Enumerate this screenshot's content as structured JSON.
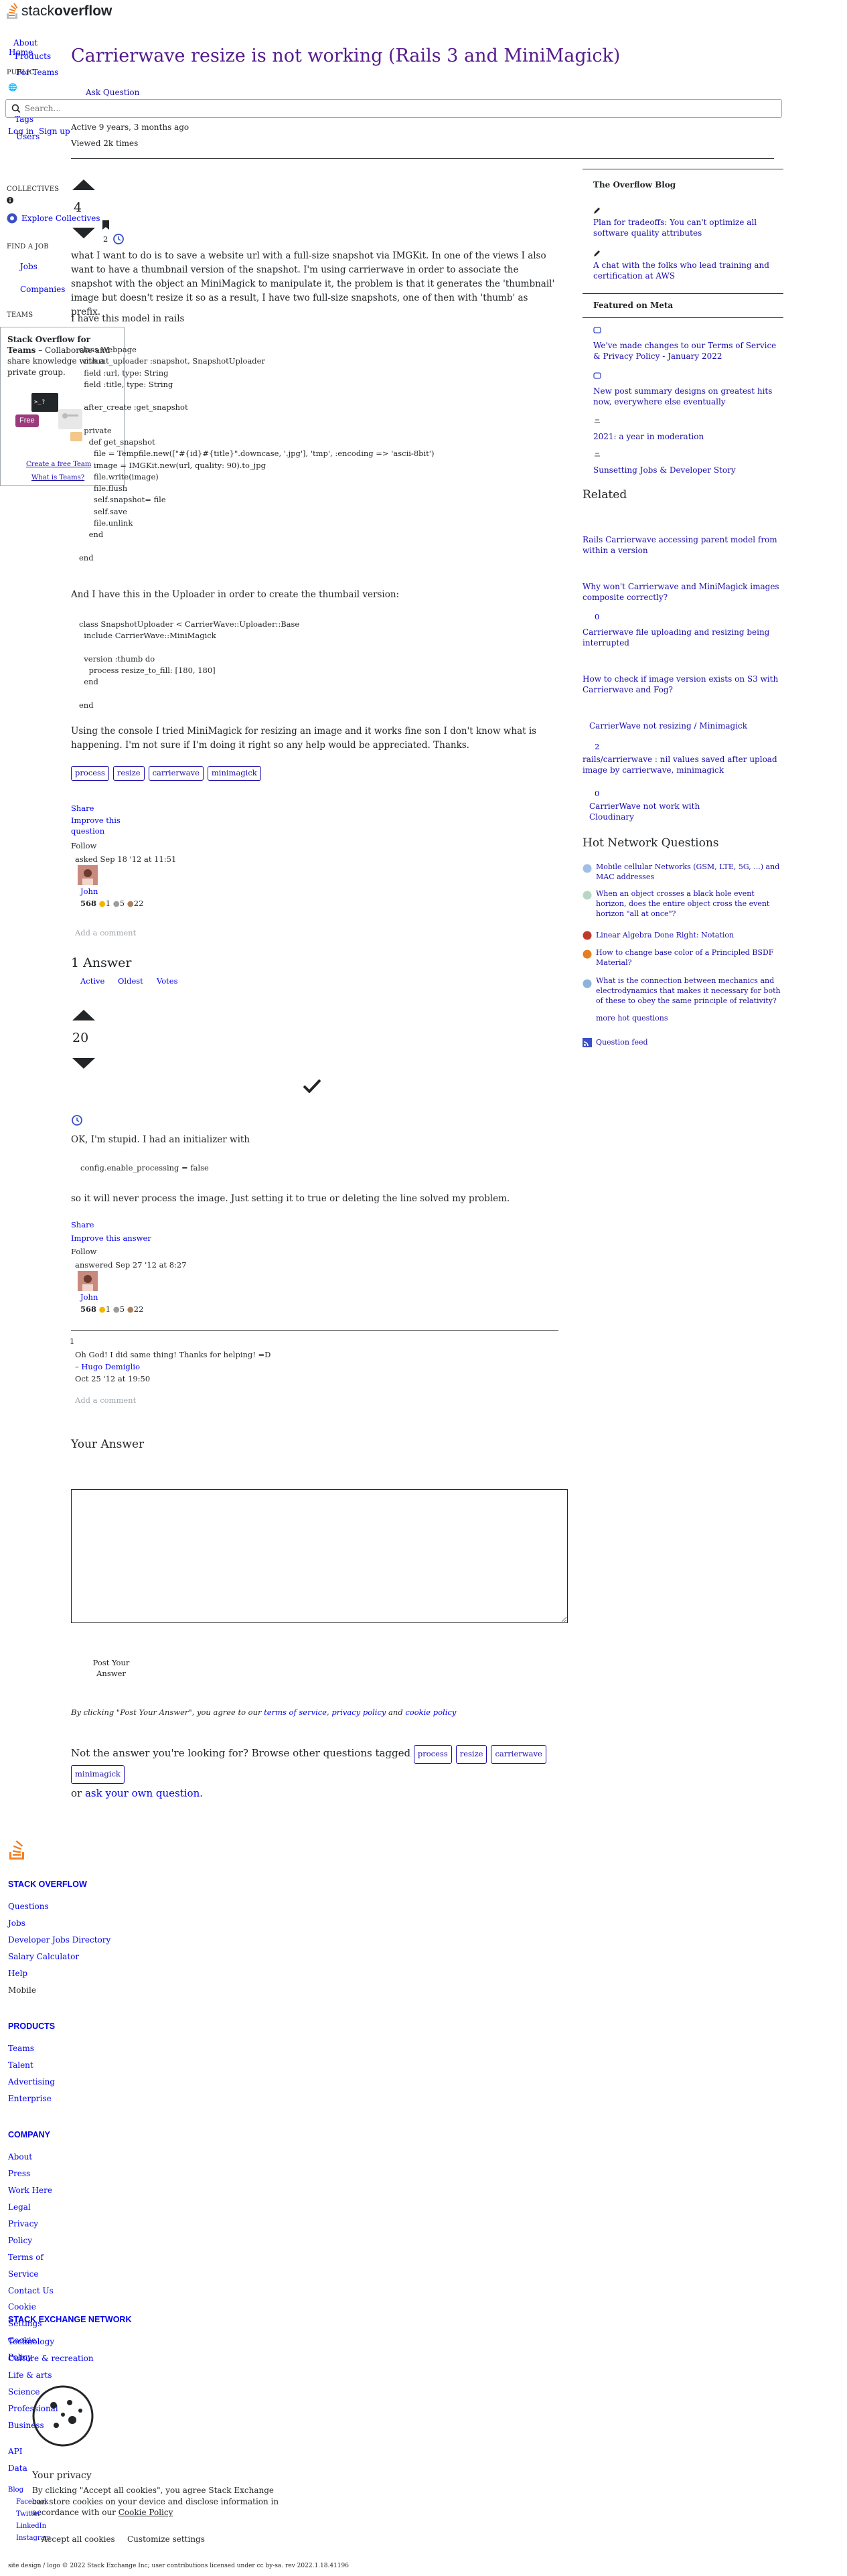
{
  "header": {
    "logo_text_light": "stack",
    "logo_text_bold": "overflow",
    "nav": [
      "Home",
      "About",
      "Products",
      "For Teams",
      "PUBLIC",
      "Stack Overflow",
      "Tags",
      "Users"
    ],
    "search_placeholder": "Search…",
    "login": "Log in",
    "signup": "Sign up"
  },
  "left_nav": {
    "collectives_label": "COLLECTIVES",
    "explore_collectives": "Explore Collectives",
    "find_a_job_label": "FIND A JOB",
    "jobs": "Jobs",
    "companies": "Companies",
    "teams_label": "TEAMS",
    "teams_box": {
      "title": "Stack Overflow for Teams",
      "desc": " – Collaborate and share knowledge with a private group.",
      "free_badge": "Free",
      "create_link": "Create a free Team",
      "what_link": "What is Teams?"
    }
  },
  "question": {
    "title": "Carrierwave resize is not working (Rails 3 and MiniMagick)",
    "ask_button": "Ask Question",
    "active": "Active 9 years, 3 months ago",
    "viewed": "Viewed 2k times",
    "votes": "4",
    "bookmarks": "2",
    "body_p1": "what I want to do is to save a website url with a full-size snapshot via IMGKit. In one of the views I also want to have a thumbnail version of the snapshot. I'm using carrierwave in order to associate the snapshot with the object an MiniMagick to manipulate it, the problem is that it generates the 'thumbnail' image but doesn't resize it so as a result, I have two full-size snapshots, one of then with 'thumb' as prefix.",
    "body_p2": "I have this model in rails",
    "code1": "class Webpage\n  mount_uploader :snapshot, SnapshotUploader\n  field :url, type: String\n  field :title, type: String\n\n  after_create :get_snapshot\n\n  private\n    def get_snapshot\n      file = Tempfile.new([\"#{id}#{title}\".downcase, '.jpg'], 'tmp', :encoding => 'ascii-8bit')\n      image = IMGKit.new(url, quality: 90).to_jpg\n      file.write(image)\n      file.flush\n      self.snapshot= file\n      self.save\n      file.unlink\n    end\n\nend",
    "body_p3": "And I have this in the Uploader in order to create the thumbail version:",
    "code2": "class SnapshotUploader < CarrierWave::Uploader::Base\n  include CarrierWave::MiniMagick\n\n  version :thumb do\n    process resize_to_fill: [180, 180]\n  end\n\nend",
    "body_p4": "Using the console I tried MiniMagick for resizing an image and it works fine son I don't know what is happening. I'm not sure if I'm doing it right so any help would be appreciated. Thanks.",
    "tags": [
      "process",
      "resize",
      "carrierwave",
      "minimagick"
    ],
    "share": "Share",
    "improve": "Improve this question",
    "follow": "Follow",
    "asked": "asked Sep 18 '12 at 11:51",
    "user": {
      "name": "John",
      "rep": "568",
      "gold": "1",
      "silver": "5",
      "bronze": "22"
    },
    "add_comment": "Add a comment"
  },
  "answers": {
    "count_heading": "1 Answer",
    "sort_tabs": [
      "Active",
      "Oldest",
      "Votes"
    ],
    "answer": {
      "votes": "20",
      "body_p1": "OK, I'm stupid. I had an initializer with",
      "code": "config.enable_processing = false",
      "body_p2": "so it will never process the image. Just setting it to true or deleting the line solved my problem.",
      "share": "Share",
      "improve": "Improve this answer",
      "follow": "Follow",
      "answered": "answered Sep 27 '12 at 8:27",
      "user": {
        "name": "John",
        "rep": "568",
        "gold": "1",
        "silver": "5",
        "bronze": "22"
      },
      "comment": {
        "score": "1",
        "text": "Oh God! I did same thing! Thanks for helping! =D",
        "author": "– Hugo Demiglio",
        "date": "Oct 25 '12 at 19:50"
      },
      "add_comment": "Add a comment"
    }
  },
  "your_answer": {
    "heading": "Your Answer",
    "post_button": "Post Your Answer",
    "disclaimer_prefix": "By clicking \"Post Your Answer\", you agree to our ",
    "terms": "terms of service",
    "privacy": "privacy policy",
    "and": " and ",
    "cookie": "cookie policy",
    "not_answer_prefix": "Not the answer you're looking for? Browse other questions tagged ",
    "not_answer_or": "or ",
    "ask_own": "ask your own question",
    "period": "."
  },
  "sidebar": {
    "blog_title": "The Overflow Blog",
    "blog_items": [
      "Plan for tradeoffs: You can't optimize all software quality attributes",
      "A chat with the folks who lead training and certification at AWS"
    ],
    "meta_title": "Featured on Meta",
    "meta_items": [
      "We've made changes to our Terms of Service & Privacy Policy - January 2022",
      "New post summary designs on greatest hits now, everywhere else eventually",
      "2021: a year in moderation",
      "Sunsetting Jobs & Developer Story"
    ],
    "related_title": "Related",
    "related_items": [
      {
        "score": "",
        "text": "Rails Carrierwave accessing parent model from within a version"
      },
      {
        "score": "",
        "text": "Why won't Carrierwave and MiniMagick images composite correctly?"
      },
      {
        "score": "0",
        "text": "Carrierwave file uploading and resizing being interrupted"
      },
      {
        "score": "",
        "text": "How to check if image version exists on S3 with Carrierwave and Fog?"
      },
      {
        "score": "",
        "text": "CarrierWave not resizing / Minimagick"
      },
      {
        "score": "2",
        "text": "rails/carrierwave : nil values saved after upload image by carrierwave, minimagick"
      },
      {
        "score": "0",
        "text": "CarrierWave not work with Cloudinary"
      }
    ],
    "hnq_title": "Hot Network Questions",
    "hnq_items": [
      "Mobile cellular Networks (GSM, LTE, 5G, ...) and MAC addresses",
      "When an object crosses a black hole event horizon, does the entire object cross the event horizon \"all at once\"?",
      "Linear Algebra Done Right: Notation",
      "How to change base color of a Principled BSDF Material?",
      "What is the connection between mechanics and electrodynamics that makes it necessary for both of these to obey the same principle of relativity?"
    ],
    "more_hot": "more hot questions",
    "question_feed": "Question feed"
  },
  "footer": {
    "sections": [
      {
        "title": "STACK OVERFLOW",
        "links": [
          "Questions",
          "Jobs",
          "Developer Jobs Directory",
          "Salary Calculator",
          "Help",
          "Mobile"
        ]
      },
      {
        "title": "PRODUCTS",
        "links": [
          "Teams",
          "Talent",
          "Advertising",
          "Enterprise"
        ]
      },
      {
        "title": "COMPANY",
        "links": [
          "About",
          "Press",
          "Work Here",
          "Legal",
          "Privacy Policy",
          "Terms of Service",
          "Contact Us",
          "Cookie Settings",
          "Cookie Policy"
        ]
      },
      {
        "title": "STACK EXCHANGE NETWORK",
        "links": [
          "Technology",
          "Culture & recreation",
          "Life & arts",
          "Science",
          "Professional",
          "Business",
          "API",
          "Data"
        ]
      }
    ],
    "social": [
      "Blog",
      "Facebook",
      "Twitter",
      "LinkedIn",
      "Instagram"
    ],
    "copyright": "site design / logo © 2022 Stack Exchange Inc; user contributions licensed under cc by-sa. rev 2022.1.18.41196"
  },
  "cookie_banner": {
    "title": "Your privacy",
    "text_prefix": "By clicking \"Accept all cookies\", you agree Stack Exchange can store cookies on your device and disclose information in accordance with our ",
    "policy_link": "Cookie Policy",
    "accept": "Accept all cookies",
    "customize": "Customize settings"
  },
  "colors": {
    "link": "#1a0dab",
    "visited": "#551a8b",
    "footer_link": "#0000ee",
    "orange": "#f48024",
    "free_badge": "#9b3b7d"
  }
}
